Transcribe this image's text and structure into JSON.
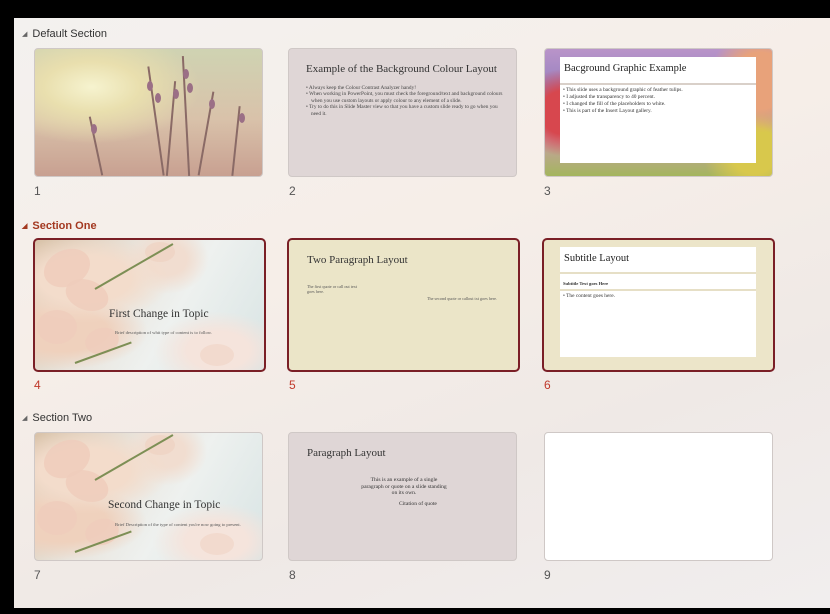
{
  "sections": [
    {
      "label": "Default Section",
      "active": false
    },
    {
      "label": "Section One",
      "active": true
    },
    {
      "label": "Section Two",
      "active": false
    }
  ],
  "slides": [
    {
      "number": "1"
    },
    {
      "number": "2",
      "title": "Example of the Background Colour Layout",
      "bullets": [
        "Always keep the Colour Contrast Analyzer handy!",
        "When working in PowerPoint, you must check the foreground/text and background colours when you use custom layouts or apply colour to any element of a slide.",
        "Try to do this in Slide Master view so that you have a custom slide ready to go when you need it."
      ]
    },
    {
      "number": "3",
      "title": "Bacground Graphic Example",
      "bullets": [
        "This slide uses a background graphic of feather tulips.",
        "I adjusted the transparency to 40 percent.",
        "I changed the fill of the placeholders to white.",
        "This is part of the Insert Layout gallery."
      ]
    },
    {
      "number": "4",
      "title": "First Change in Topic",
      "subtitle": "Brief description of whit type of content is to follow."
    },
    {
      "number": "5",
      "title": "Two Paragraph Layout",
      "p1": "The first quote or call out text goes here.",
      "p2": "The second quote or callout txt goes here."
    },
    {
      "number": "6",
      "title": "Subtitle Layout",
      "subtitle": "Subtitle Text goes Here",
      "content": "The content goes here."
    },
    {
      "number": "7",
      "title": "Second Change in Topic",
      "subtitle": "Brief Description of the type of content you're now going to present."
    },
    {
      "number": "8",
      "title": "Paragraph Layout",
      "quote": "This is an example of a single paragraph or quote on a slide standing on its own.",
      "citation": "Citation of quote"
    },
    {
      "number": "9"
    }
  ],
  "selected_slides": [
    "4",
    "5",
    "6"
  ],
  "colors": {
    "accent": "#a33820",
    "selection_border": "#7a1f26"
  }
}
